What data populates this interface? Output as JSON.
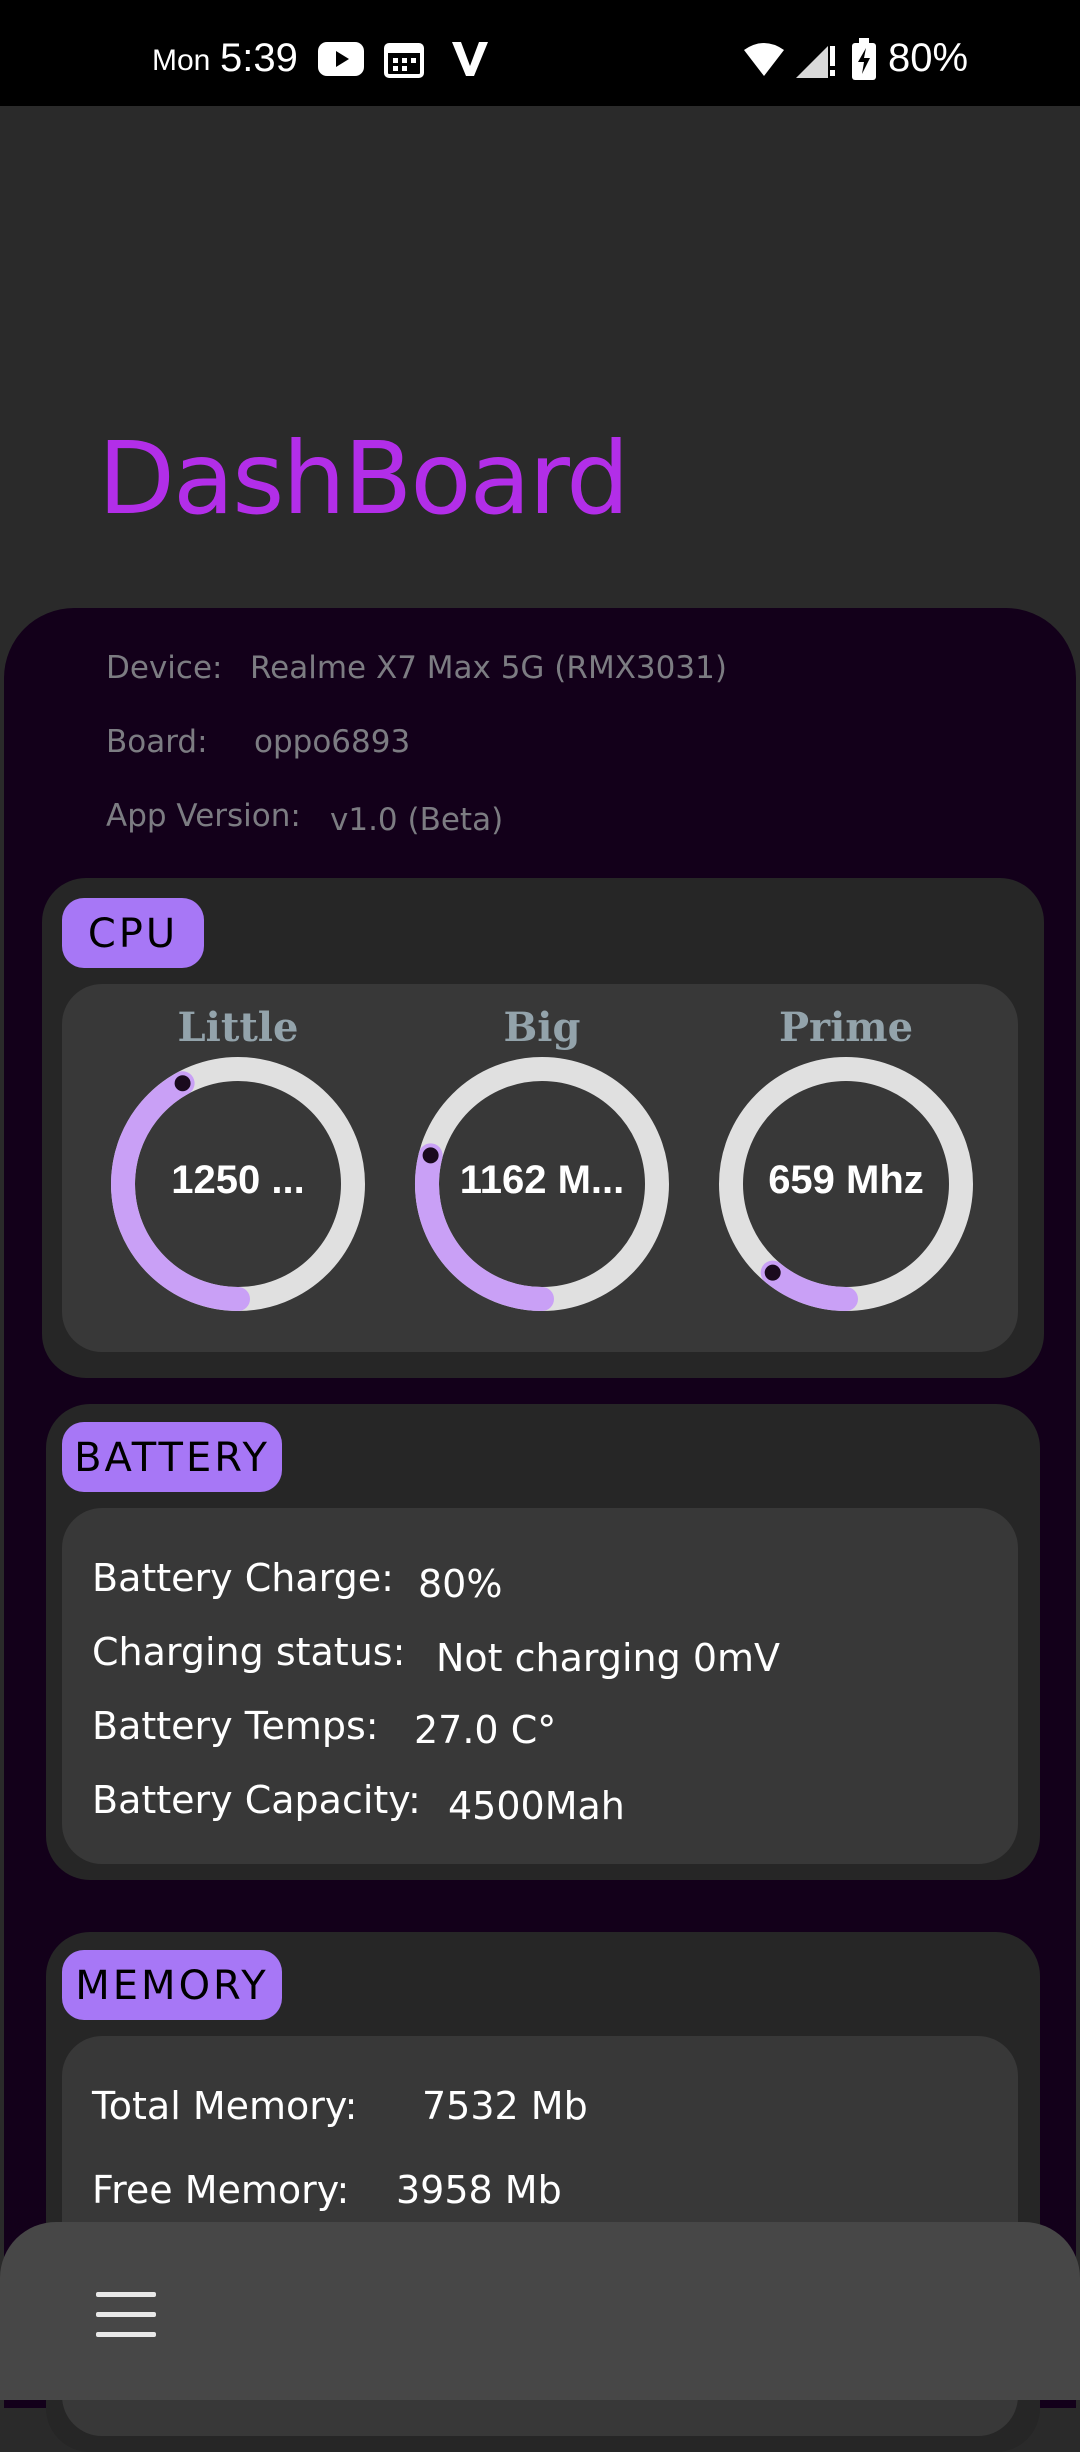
{
  "status_bar": {
    "day": "Mon",
    "time": "5:39",
    "battery": "80%"
  },
  "title": "DashBoard",
  "device_info": {
    "device_label": "Device:",
    "device_value": "Realme X7 Max 5G (RMX3031)",
    "board_label": "Board:",
    "board_value": "oppo6893",
    "version_label": "App Version:",
    "version_value": "v1.0 (Beta)"
  },
  "cpu": {
    "badge": "CPU",
    "gauges": [
      {
        "label": "Little",
        "value_text": "1250 ...",
        "fraction": 0.42
      },
      {
        "label": "Big",
        "value_text": "1162 M...",
        "fraction": 0.29
      },
      {
        "label": "Prime",
        "value_text": "659 Mhz",
        "fraction": 0.11
      }
    ]
  },
  "battery": {
    "badge": "BATTERY",
    "rows": [
      {
        "label": "Battery Charge:",
        "value": "80%"
      },
      {
        "label": "Charging status:",
        "value": "Not charging 0mV"
      },
      {
        "label": "Battery Temps:",
        "value": "27.0 C°"
      },
      {
        "label": "Battery Capacity:",
        "value": "4500Mah"
      }
    ]
  },
  "memory": {
    "badge": "MEMORY",
    "rows": [
      {
        "label": "Total Memory:",
        "value": "7532 Mb"
      },
      {
        "label": "Free Memory:",
        "value": "3958 Mb"
      }
    ]
  },
  "colors": {
    "accent": "#a777f6",
    "title": "#b22ee8",
    "gauge_track": "#e0e0e0",
    "gauge_fill": "#c9a0f6"
  },
  "icons": [
    "youtube-icon",
    "calendar-icon",
    "v-app-icon",
    "wifi-icon",
    "signal-icon",
    "battery-icon",
    "menu-icon"
  ]
}
